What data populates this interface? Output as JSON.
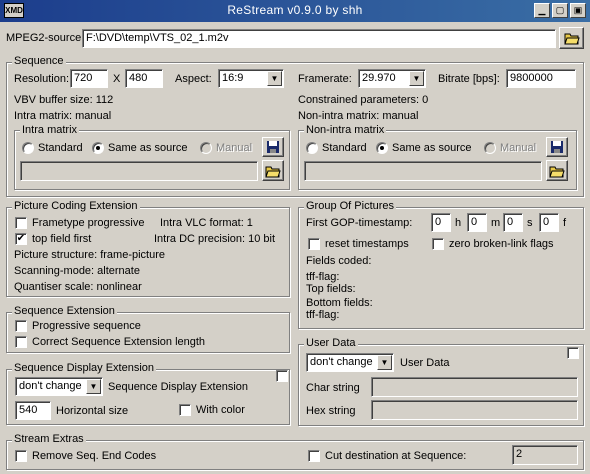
{
  "window": {
    "title": "ReStream v0.9.0 by shh",
    "app_icon_text": "XMD"
  },
  "source": {
    "label": "MPEG2-source:",
    "path": "F:\\DVD\\temp\\VTS_02_1.m2v"
  },
  "sequence": {
    "title": "Sequence",
    "resolution_label": "Resolution:",
    "width": "720",
    "x_label": "X",
    "height": "480",
    "aspect_label": "Aspect:",
    "aspect_value": "16:9",
    "framerate_label": "Framerate:",
    "framerate_value": "29.970",
    "bitrate_label": "Bitrate [bps]:",
    "bitrate_value": "9800000",
    "vbv_text": "VBV buffer size: 112",
    "constrained_text": "Constrained parameters: 0",
    "intra_matrix_text": "Intra matrix: manual",
    "nonintra_matrix_text": "Non-intra matrix: manual",
    "intra_group": {
      "title": "Intra matrix",
      "standard": "Standard",
      "same": "Same as source",
      "manual": "Manual"
    },
    "nonintra_group": {
      "title": "Non-intra matrix",
      "standard": "Standard",
      "same": "Same as source",
      "manual": "Manual"
    }
  },
  "pce": {
    "title": "Picture Coding Extension",
    "frametype_label": "Frametype progressive",
    "topfield_label": "top field first",
    "intra_vlc": "Intra VLC format: 1",
    "intra_dc": "Intra DC precision: 10 bit",
    "picture_structure": "Picture structure: frame-picture",
    "scanning_mode": "Scanning-mode: alternate",
    "quantizer": "Quantiser scale: nonlinear"
  },
  "gop": {
    "title": "Group Of Pictures",
    "timestamp_label": "First GOP-timestamp:",
    "h_value": "0",
    "h_label": "h",
    "m_value": "0",
    "m_label": "m",
    "s_value": "0",
    "s_label": "s",
    "f_value": "0",
    "f_label": "f",
    "reset_label": "reset timestamps",
    "zero_label": "zero broken-link flags",
    "fields_coded": "Fields coded:",
    "tff1": "tff-flag:",
    "top_fields": "Top fields:",
    "bottom_fields": "Bottom fields:",
    "tff2": "tff-flag:"
  },
  "seq_ext": {
    "title": "Sequence Extension",
    "progressive": "Progressive sequence",
    "correct": "Correct Sequence Extension length"
  },
  "seq_disp": {
    "title": "Sequence Display Extension",
    "combo_value": "don't change",
    "combo_label": "Sequence Display Extension",
    "hsize_value": "540",
    "hsize_label": "Horizontal size",
    "withcolor": "With color"
  },
  "user_data": {
    "title": "User Data",
    "combo_value": "don't change",
    "combo_label": "User Data",
    "char_label": "Char string",
    "hex_label": "Hex string"
  },
  "extras": {
    "title": "Stream Extras",
    "remove_label": "Remove Seq. End Codes",
    "cut_label": "Cut destination at Sequence:",
    "cut_value": "2"
  },
  "colors": {
    "titlebar": "#3a6ea5",
    "face": "#d4d0c8"
  }
}
